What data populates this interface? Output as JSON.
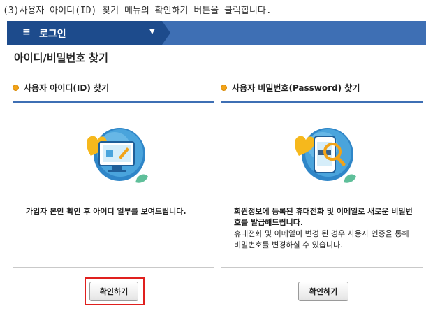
{
  "caption": "(3)사용자 아이디(ID) 찾기 메뉴의 확인하기 버튼을 클릭합니다.",
  "navbar": {
    "menu_icon": "hamburger-icon",
    "title": "로그인",
    "caret_icon": "caret-down-icon"
  },
  "page_title": "아이디/비밀번호 찾기",
  "left_section": {
    "label": "사용자 아이디(ID) 찾기",
    "description_bold": "가입자 본인 확인 후 아이디 일부를 보여드립니다.",
    "button_label": "확인하기"
  },
  "right_section": {
    "label": "사용자 비밀번호(Password) 찾기",
    "description_bold": "회원정보에 등록된 휴대전화 및 이메일로 새로운 비밀번호를 발급해드립니다.",
    "description": "휴대전화 및 이메일이 변경 된 경우 사용자 인증을 통해 비밀번호를 변경하실 수 있습니다.",
    "button_label": "확인하기"
  },
  "colors": {
    "nav_dark": "#1d4b8c",
    "nav_light": "#3e6fb4",
    "bullet": "#f2a318",
    "highlight": "#e0201e"
  }
}
